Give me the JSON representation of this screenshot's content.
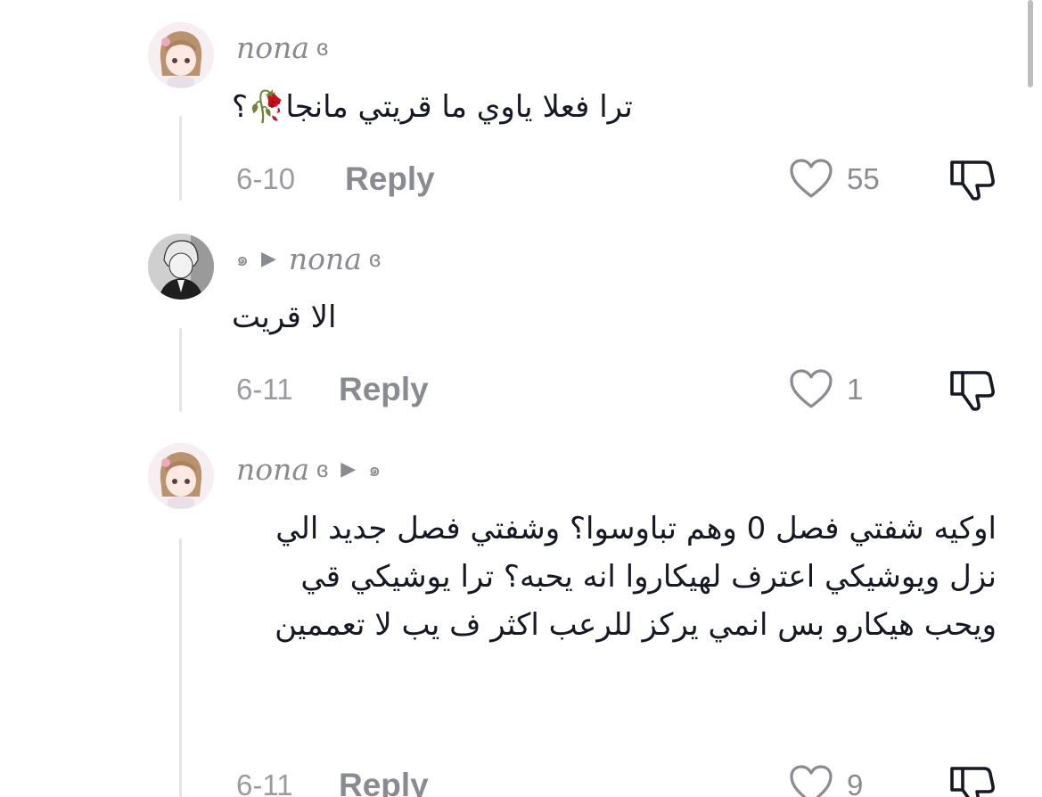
{
  "comments": [
    {
      "author": "nona",
      "author_glyph": "ɞ",
      "text": "ترا فعلا ياوي ما قريتي مانجا🥀؟",
      "date": "6-10",
      "reply_label": "Reply",
      "likes": "55"
    },
    {
      "reply_to_prefix": "๑",
      "author": "nona",
      "author_glyph": "ɞ",
      "text": "الا قريت",
      "date": "6-11",
      "reply_label": "Reply",
      "likes": "1"
    },
    {
      "author": "nona",
      "author_glyph": "ɞ",
      "reply_to_suffix": "๑",
      "text": "اوكيه شفتي فصل 0 وهم تباوسوا؟ وشفتي فصل جديد الي نزل ويوشيكي اعترف لهيكاروا انه يحبه؟ ترا يوشيكي قي ويحب هيكارو بس انمي يركز للرعب اكثر ف يب لا تعممين",
      "date": "6-11",
      "reply_label": "Reply",
      "likes": "9"
    }
  ],
  "icons": {
    "like": "heart-outline-icon",
    "dislike": "thumbs-down-icon",
    "reply_arrow": "play-triangle-icon"
  },
  "colors": {
    "muted": "#8a8b91",
    "text": "#161823",
    "thread_line": "#e4e4e4"
  }
}
